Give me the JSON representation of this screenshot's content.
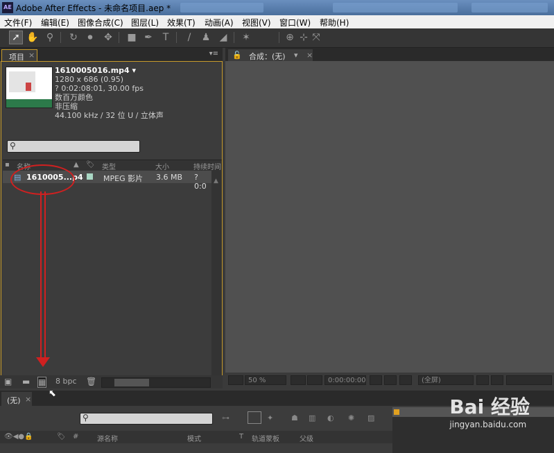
{
  "window": {
    "title": "Adobe After Effects - 未命名项目.aep *",
    "app_badge": "AE"
  },
  "menu": [
    "文件(F)",
    "编辑(E)",
    "图像合成(C)",
    "图层(L)",
    "效果(T)",
    "动画(A)",
    "视图(V)",
    "窗口(W)",
    "帮助(H)"
  ],
  "project": {
    "tab_label": "项目",
    "tab_close": "×",
    "panel_menu": "▾≡",
    "file": {
      "name": "1610005016.mp4 ▾",
      "dims": "1280 x 686 (0.95)",
      "duration": "? 0:02:08:01, 30.00 fps",
      "color": "数百万颜色",
      "compression": "非压缩",
      "audio": "44.100 kHz / 32 位 U / 立体声"
    },
    "columns": {
      "name": "名称",
      "type": "类型",
      "size": "大小",
      "duration": "持续时间"
    },
    "row": {
      "name": "1610005...p4",
      "type": "MPEG 影片",
      "size": "3.6 MB",
      "duration": "? 0:0"
    },
    "bpc": "8 bpc"
  },
  "composition": {
    "tab_label": "合成：(无)",
    "tab_close": "×",
    "zoom": "50 %",
    "timecode": "0:00:00:00",
    "resolution": "(全屏)"
  },
  "timeline": {
    "tab_label": "(无)",
    "tab_close": "×",
    "columns": {
      "num": "#",
      "source": "源名称",
      "mode": "模式",
      "t": "T",
      "trkmat": "轨道蒙板",
      "parent": "父级"
    }
  },
  "watermark": {
    "logo": "Bai 经验",
    "url": "jingyan.baidu.com"
  },
  "colors": {
    "panel_highlight": "#c89b2a",
    "annotation": "#d02020"
  }
}
